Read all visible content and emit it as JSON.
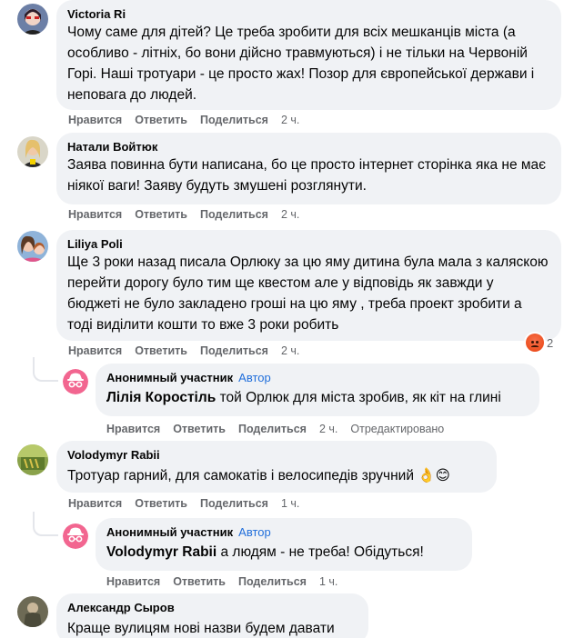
{
  "comments": [
    {
      "author": "Victoria Ri",
      "text": "Чому саме для дітей? Це треба зробити для всіх мешканців міста (а особливо - літніх, бо вони дійсно травмуються) і не тільки на Червоній Горі. Наші тротуари - це просто жах! Позор для європейської держави і неповага до людей.",
      "actions": {
        "like": "Нравится",
        "reply": "Ответить",
        "share": "Поделиться",
        "time": "2 ч."
      }
    },
    {
      "author": "Натали Войтюк",
      "text": "Заява повинна бути написана, бо це просто інтернет сторінка яка не має ніякої ваги! Заяву будуть змушені розглянути.",
      "actions": {
        "like": "Нравится",
        "reply": "Ответить",
        "share": "Поделиться",
        "time": "2 ч."
      }
    },
    {
      "author": "Liliya Poli",
      "text": "Ще 3 роки назад писала Орлюку за цю яму дитина була мала з каляскою перейти дорогу було тим ще квестом але у відповідь як завжди у бюджеті не було закладено гроші на цю яму , треба проект зробити а тоді виділити кошти то вже 3 роки робить",
      "actions": {
        "like": "Нравится",
        "reply": "Ответить",
        "share": "Поделиться",
        "time": "2 ч."
      },
      "reaction_count": "2",
      "reply": {
        "author": "Анонимный участник",
        "badge": "Автор",
        "mention": "Лілія Коростіль",
        "text": "той Орлюк для міста зробив, як кіт на глині",
        "actions": {
          "like": "Нравится",
          "reply": "Ответить",
          "share": "Поделиться",
          "time": "2 ч.",
          "edited": "Отредактировано"
        }
      }
    },
    {
      "author": "Volodymyr Rabii",
      "text": "Тротуар гарний, для самокатів і велосипедів зручний 👌😊",
      "actions": {
        "like": "Нравится",
        "reply": "Ответить",
        "share": "Поделиться",
        "time": "1 ч."
      },
      "reply": {
        "author": "Анонимный участник",
        "badge": "Автор",
        "mention": "Volodymyr Rabii",
        "text": "а людям - не треба! Обідуться!",
        "actions": {
          "like": "Нравится",
          "reply": "Ответить",
          "share": "Поделиться",
          "time": "1 ч."
        }
      }
    },
    {
      "author": "Александр Сыров",
      "text": "Краще вулицям нові назви будем давати"
    }
  ]
}
